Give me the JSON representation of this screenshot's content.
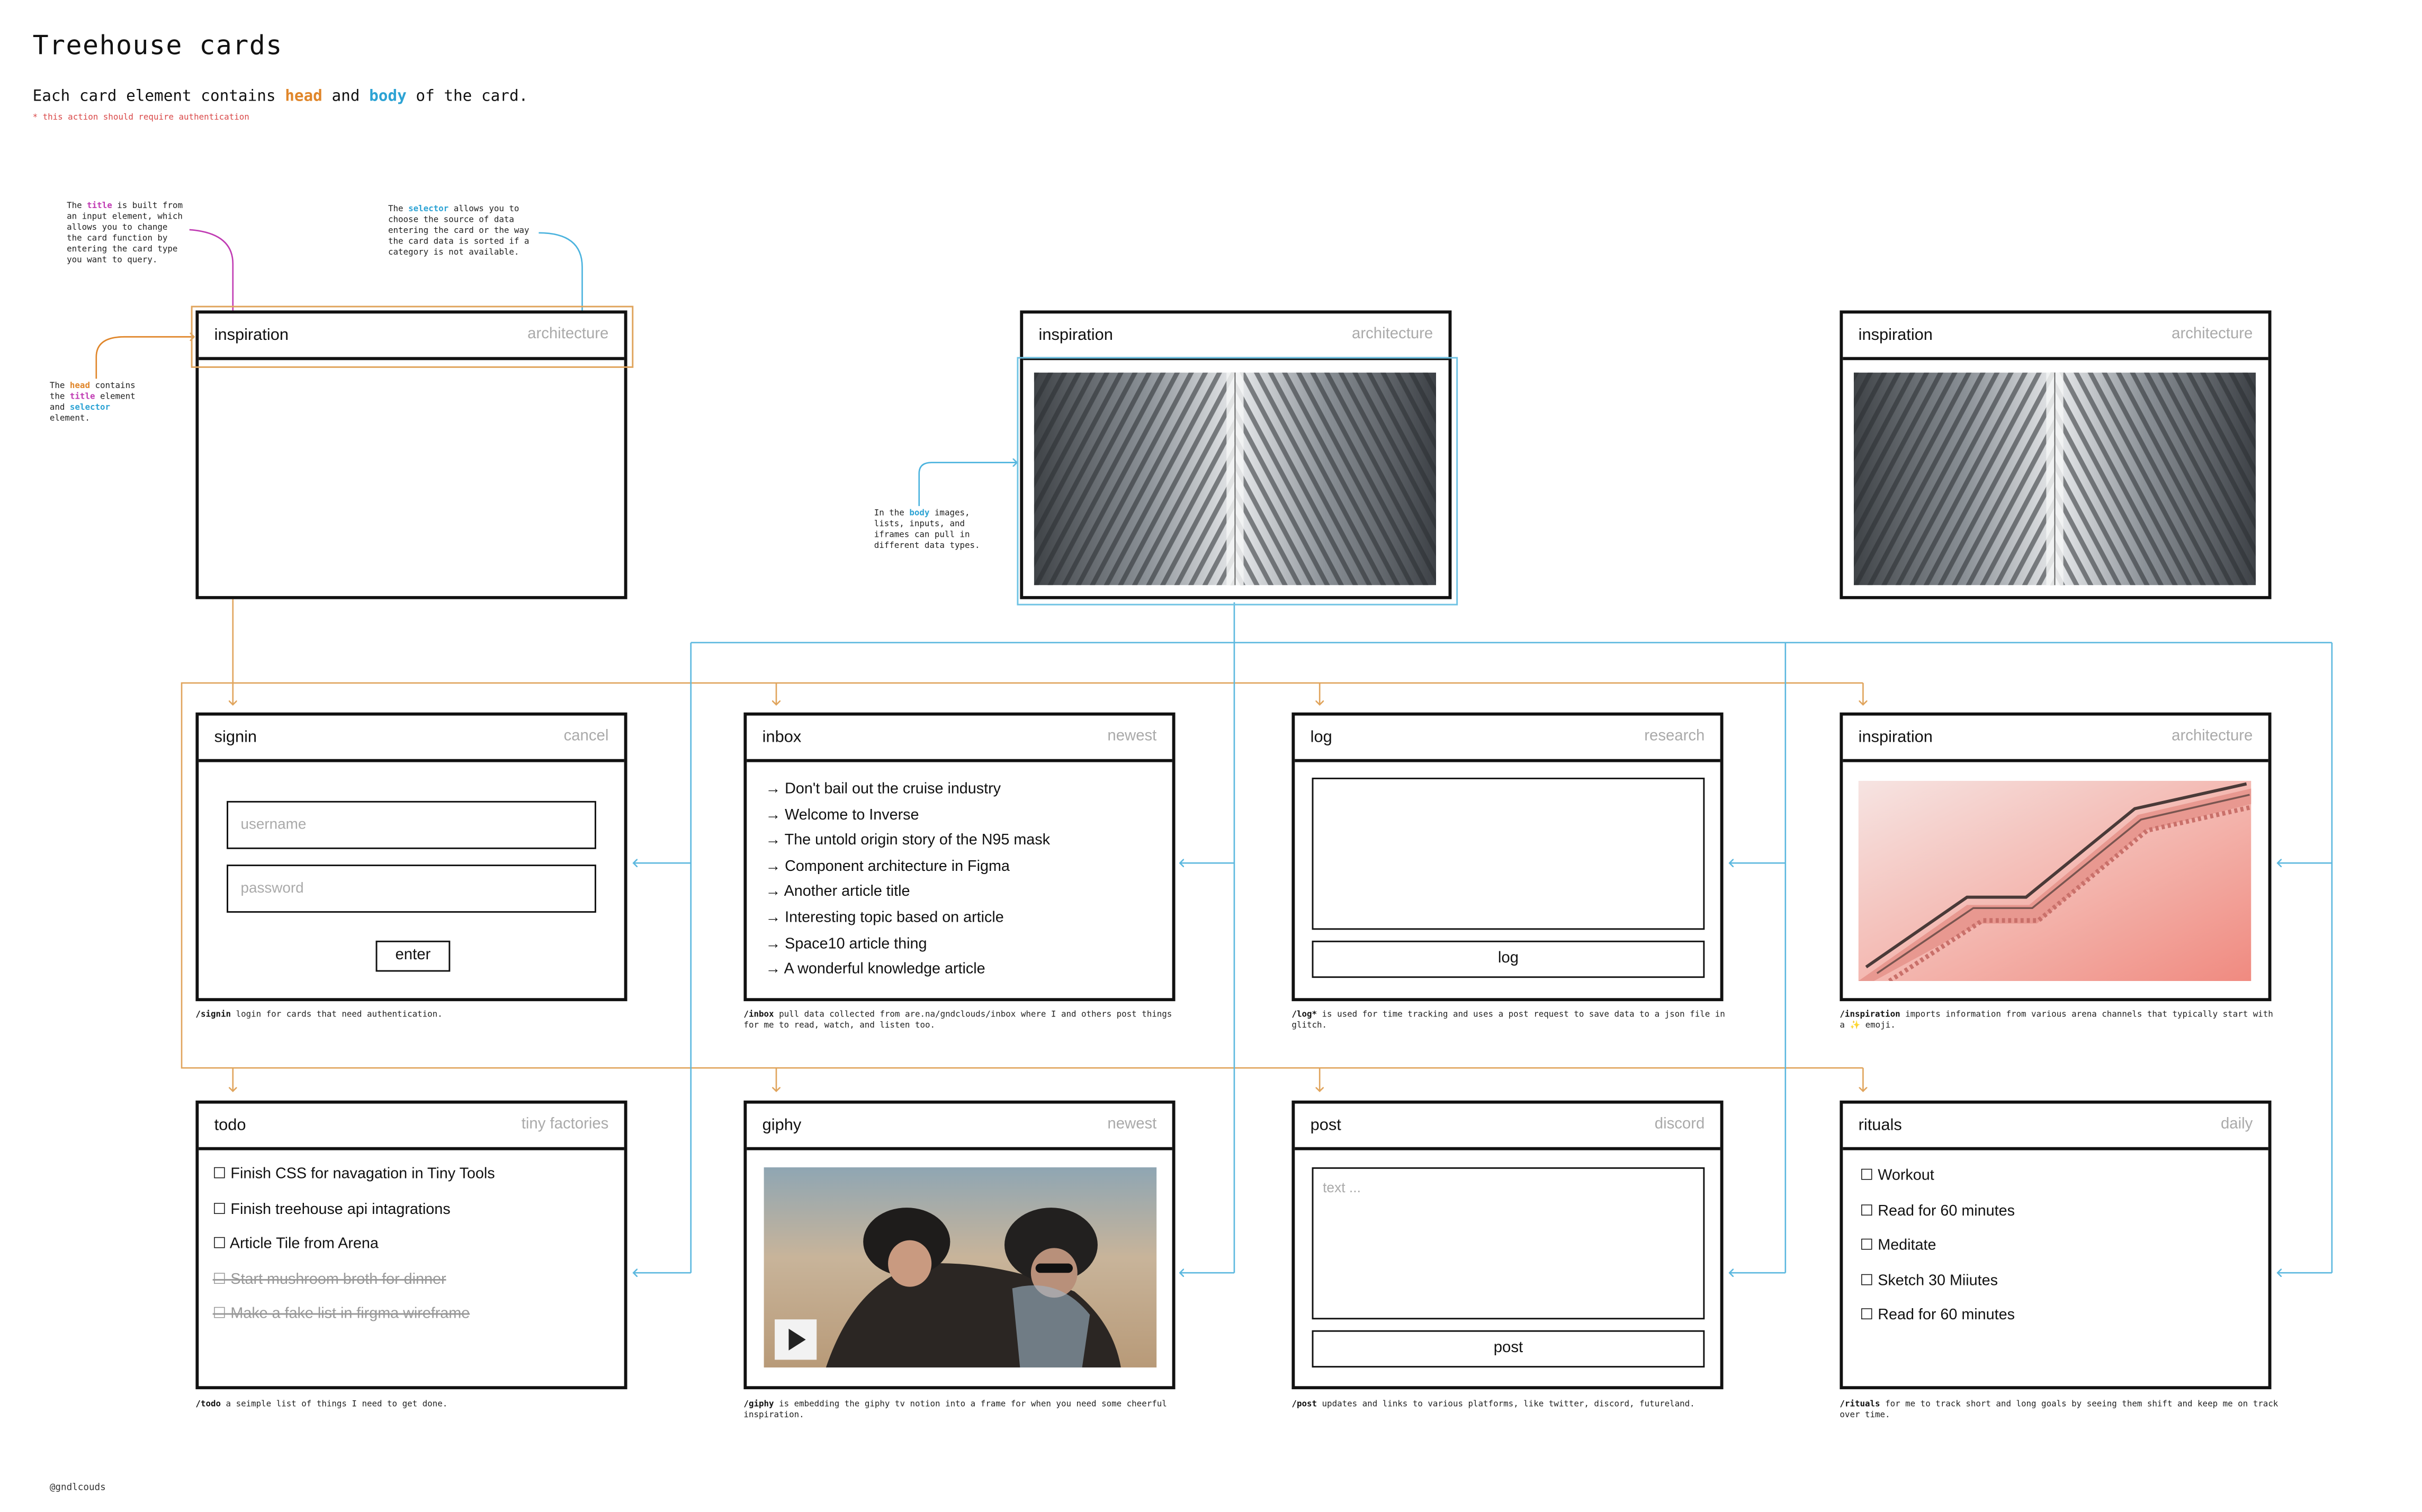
{
  "title": "Treehouse cards",
  "subtitle": {
    "prefix": "Each card element contains ",
    "head": "head",
    "and": " and ",
    "body": "body",
    "suffix": " of the card."
  },
  "auth_note": "* this action should require authentication",
  "notes": {
    "title_note": {
      "a": "The ",
      "kw": "title",
      "b": " is built from\nan input element, which\nallows you to change\nthe card function by\nentering the card type\nyou want to query."
    },
    "selector_note": {
      "a": "The ",
      "kw": "selector",
      "b": " allows you to\nchoose the source of data\nentering the card or the way\nthe card data is sorted if a\ncategory is not available."
    },
    "head_note": {
      "a": "The ",
      "kw1": "head",
      "b": " contains\nthe ",
      "kw2": "title",
      "c": " element\nand ",
      "kw3": "selector",
      "d": "\nelement."
    },
    "body_note": {
      "a": "In the ",
      "kw": "body",
      "b": " images,\nlists, inputs, and\niframes can pull in\ndifferent data types."
    }
  },
  "top_cards": [
    {
      "title": "inspiration",
      "selector": "architecture"
    },
    {
      "title": "inspiration",
      "selector": "architecture"
    },
    {
      "title": "inspiration",
      "selector": "architecture"
    }
  ],
  "signin": {
    "title": "signin",
    "selector": "cancel",
    "username_placeholder": "username",
    "password_placeholder": "password",
    "button": "enter",
    "caption_cmd": "/signin",
    "caption": " login for cards that need authentication."
  },
  "inbox": {
    "title": "inbox",
    "selector": "newest",
    "items": [
      "→ Don't bail out the cruise industry",
      "→ Welcome to Inverse",
      "→ The untold origin story of the N95 mask",
      "→ Component architecture in Figma",
      "→ Another article title",
      "→ Interesting topic based on article",
      "→ Space10 article thing",
      "→ A wonderful knowledge article"
    ],
    "caption_cmd": "/inbox",
    "caption": " pull data collected from are.na/gndclouds/inbox where I and others post things for me to read, watch, and listen too."
  },
  "log": {
    "title": "log",
    "selector": "research",
    "button": "log",
    "caption_cmd": "/log*",
    "caption": " is used for time tracking and uses a post request to save data to a json file in glitch."
  },
  "inspiration": {
    "title": "inspiration",
    "selector": "architecture",
    "caption_cmd": "/inspiration",
    "caption": " imports information from various arena channels that typically start with a ✨ emoji."
  },
  "todo": {
    "title": "todo",
    "selector": "tiny factories",
    "items": [
      {
        "text": "☐  Finish CSS for navagation in Tiny Tools",
        "done": false
      },
      {
        "text": "☐ Finish treehouse api intagrations",
        "done": false
      },
      {
        "text": "☐ Article Tile from Arena",
        "done": false
      },
      {
        "text": "☐  Start mushroom broth for dinner",
        "done": true
      },
      {
        "text": "☐  Make a fake list in firgma wireframe",
        "done": true
      }
    ],
    "caption_cmd": "/todo",
    "caption": " a seimple list of things I need to get done."
  },
  "giphy": {
    "title": "giphy",
    "selector": "newest",
    "play_icon": "play-icon",
    "caption_cmd": "/giphy",
    "caption": " is embedding the giphy tv notion into a frame for when you need some cheerful inspiration."
  },
  "post": {
    "title": "post",
    "selector": "discord",
    "placeholder": "text ...",
    "button": "post",
    "caption_cmd": "/post",
    "caption": " updates and links to various platforms, like twitter, discord, futureland."
  },
  "rituals": {
    "title": "rituals",
    "selector": "daily",
    "items": [
      "☐  Workout",
      "☐  Read for 60 minutes",
      "☐  Meditate",
      "☐  Sketch 30 Miiutes",
      "☐  Read for 60 minutes"
    ],
    "caption_cmd": "/rituals",
    "caption": " for me to track short and long goals by seeing them shift and keep me on track over time."
  },
  "footer": "@gndlcouds",
  "colors": {
    "head": "#e0862a",
    "body": "#2da3d4",
    "title_kw": "#c03bb3",
    "auth": "#d94848"
  }
}
